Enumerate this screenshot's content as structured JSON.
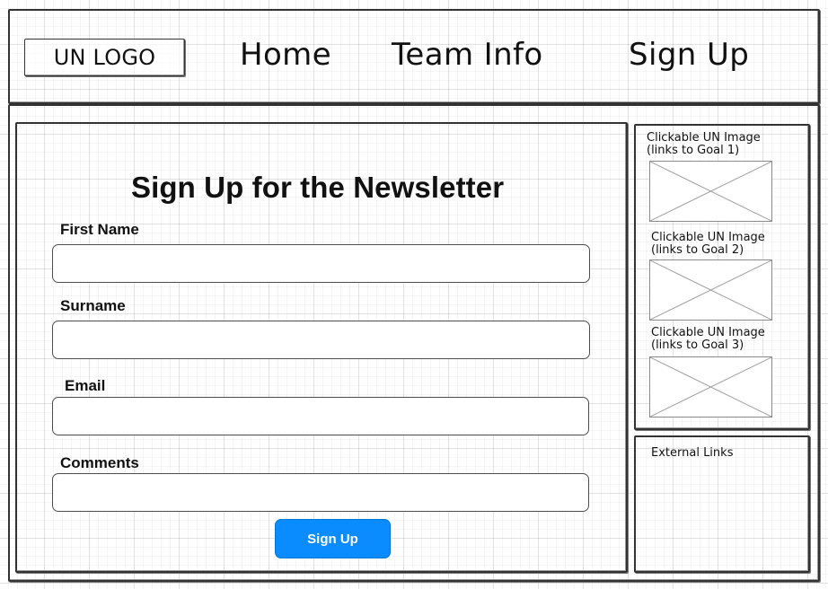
{
  "header": {
    "logo_text": "UN LOGO",
    "nav": [
      "Home",
      "Team Info",
      "Sign Up"
    ]
  },
  "form": {
    "title": "Sign Up for the Newsletter",
    "fields": [
      {
        "label": "First Name",
        "value": "",
        "placeholder": ""
      },
      {
        "label": "Surname",
        "value": "",
        "placeholder": ""
      },
      {
        "label": "Email",
        "value": "",
        "placeholder": ""
      },
      {
        "label": "Comments",
        "value": "",
        "placeholder": ""
      }
    ],
    "submit_label": "Sign Up",
    "submit_color": "#0a8cff"
  },
  "sidebar": {
    "images": [
      {
        "line1": "Clickable UN Image",
        "line2": "(links to Goal 1)",
        "icon": "image-placeholder-icon"
      },
      {
        "line1": "Clickable UN Image",
        "line2": "(links to Goal 2)",
        "icon": "image-placeholder-icon"
      },
      {
        "line1": "Clickable UN Image",
        "line2": "(links to Goal 3)",
        "icon": "image-placeholder-icon"
      }
    ],
    "external_links_label": "External Links"
  }
}
